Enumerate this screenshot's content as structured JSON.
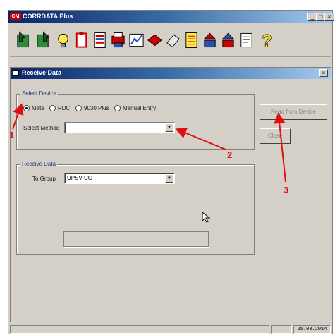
{
  "app": {
    "title": "CORRDATA Plus",
    "logo": "CM"
  },
  "window_controls": {
    "minimize": "_",
    "maximize": "□",
    "close": "×"
  },
  "toolbar": {
    "icons": [
      "import-icon",
      "export-icon",
      "lightbulb-icon",
      "clipboard-icon",
      "report-icon",
      "printer-icon",
      "chart-icon",
      "book-icon",
      "eraser-icon",
      "notes-icon",
      "download-icon",
      "upload-icon",
      "properties-icon",
      "help-icon"
    ]
  },
  "dialog": {
    "title": "Receive Data",
    "close": "×",
    "select_device": {
      "group_label": "Select Device",
      "options": [
        "Mate",
        "RDC",
        "9030 Plus",
        "Manual Entry"
      ],
      "selected": "Mate",
      "method_label": "Select Method",
      "method_value": ""
    },
    "receive_data": {
      "group_label": "Receive Data",
      "to_group_label": "To Group",
      "to_group_value": "UPSV-UG"
    },
    "buttons": {
      "read": "Read from Device",
      "close": "Close"
    }
  },
  "status": {
    "date": "25.03.2014"
  },
  "annotations": [
    "1",
    "2",
    "3"
  ],
  "colors": {
    "accent": "#0a246a",
    "annotation": "#e01010"
  }
}
